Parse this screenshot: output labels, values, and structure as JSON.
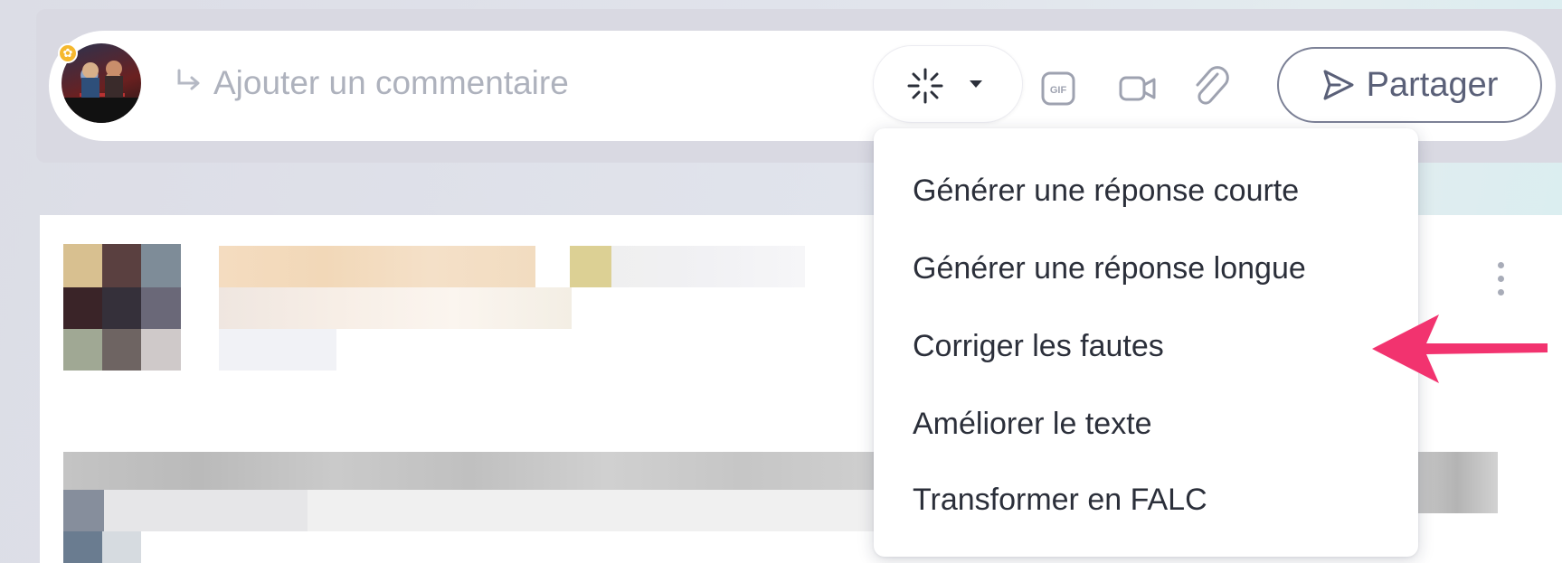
{
  "composer": {
    "input_placeholder": "Ajouter un commentaire",
    "avatar_badge_icon": "flower-badge-icon",
    "reply_icon": "reply-arrow-icon",
    "ai_button_icon": "sparkle-icon",
    "ai_dropdown_icon": "caret-down-icon",
    "tools": [
      "gif-icon",
      "video-camera-icon",
      "paperclip-icon"
    ],
    "share": {
      "icon": "send-icon",
      "label": "Partager"
    }
  },
  "ai_menu": {
    "items": [
      {
        "label": "Générer une réponse courte"
      },
      {
        "label": "Générer une réponse longue"
      },
      {
        "label": "Corriger les fautes"
      },
      {
        "label": "Améliorer le texte"
      },
      {
        "label": "Transformer en FALC"
      }
    ]
  },
  "post": {
    "menu_icon": "more-vertical-icon"
  },
  "annotation": {
    "arrow_color": "#f2336f",
    "arrow_icon": "pointer-arrow-icon"
  }
}
